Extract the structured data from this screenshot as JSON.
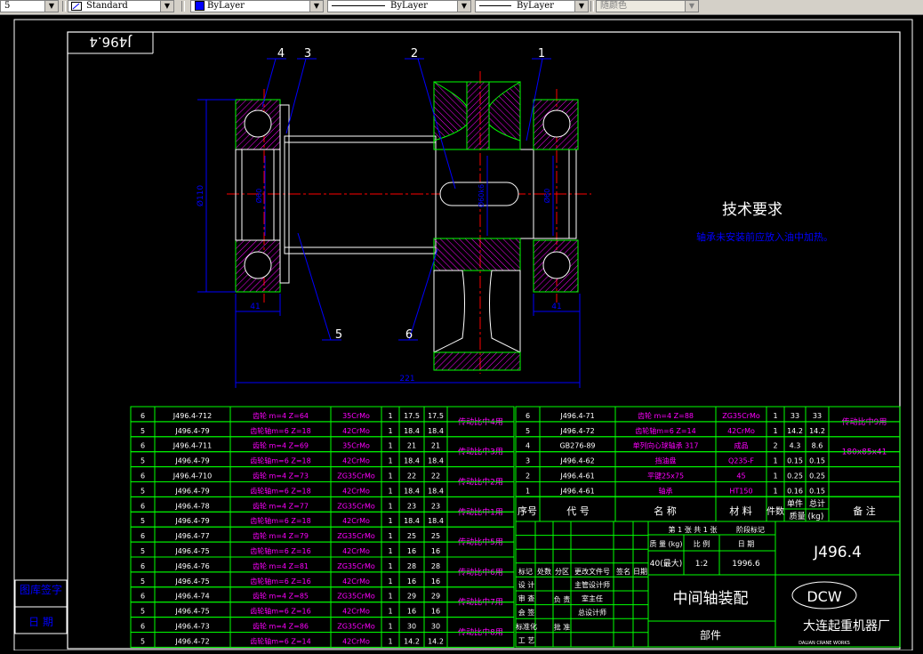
{
  "toolbar": {
    "text_style_partial": "5",
    "text_style": "Standard",
    "color": "ByLayer",
    "linetype": "ByLayer",
    "lineweight": "ByLayer",
    "plotstyle": "随颜色"
  },
  "drawing": {
    "title_block_mirror": "J496.4",
    "balloons": [
      "4",
      "3",
      "2",
      "1",
      "5",
      "6"
    ],
    "dims": {
      "width_left": "41",
      "width_right": "41",
      "overall": "221",
      "dia_bearing": "Ø110",
      "dia_shaft_left": "Ø60",
      "dia_shaft_right": "Ø60",
      "dia_gear": "Ø60k6"
    },
    "tech_req_title": "技术要求",
    "tech_req_text": "轴承未安装前应放入油中加热。",
    "left_table": [
      [
        "6",
        "J496.4-712",
        "齿轮 m=4 Z=64",
        "35CrMo",
        "1",
        "17.5",
        "17.5",
        "传动比中4用"
      ],
      [
        "5",
        "J496.4-79",
        "齿轮轴m=6 Z=18",
        "42CrMo",
        "1",
        "18.4",
        "18.4",
        ""
      ],
      [
        "6",
        "J496.4-711",
        "齿轮 m=4 Z=69",
        "35CrMo",
        "1",
        "21",
        "21",
        "传动比中3用"
      ],
      [
        "5",
        "J496.4-79",
        "齿轮轴m=6 Z=18",
        "42CrMo",
        "1",
        "18.4",
        "18.4",
        ""
      ],
      [
        "6",
        "J496.4-710",
        "齿轮 m=4 Z=73",
        "ZG35CrMo",
        "1",
        "22",
        "22",
        "传动比中2用"
      ],
      [
        "5",
        "J496.4-79",
        "齿轮轴m=6 Z=18",
        "42CrMo",
        "1",
        "18.4",
        "18.4",
        ""
      ],
      [
        "6",
        "J496.4-78",
        "齿轮 m=4 Z=77",
        "ZG35CrMo",
        "1",
        "23",
        "23",
        "传动比中1用"
      ],
      [
        "5",
        "J496.4-79",
        "齿轮轴m=6 Z=18",
        "42CrMo",
        "1",
        "18.4",
        "18.4",
        ""
      ],
      [
        "6",
        "J496.4-77",
        "齿轮 m=4 Z=79",
        "ZG35CrMo",
        "1",
        "25",
        "25",
        "传动比中5用"
      ],
      [
        "5",
        "J496.4-75",
        "齿轮轴m=6 Z=16",
        "42CrMo",
        "1",
        "16",
        "16",
        ""
      ],
      [
        "6",
        "J496.4-76",
        "齿轮 m=4 Z=81",
        "ZG35CrMo",
        "1",
        "28",
        "28",
        "传动比中6用"
      ],
      [
        "5",
        "J496.4-75",
        "齿轮轴m=6 Z=16",
        "42CrMo",
        "1",
        "16",
        "16",
        ""
      ],
      [
        "6",
        "J496.4-74",
        "齿轮 m=4 Z=85",
        "ZG35CrMo",
        "1",
        "29",
        "29",
        "传动比中7用"
      ],
      [
        "5",
        "J496.4-75",
        "齿轮轴m=6 Z=16",
        "42CrMo",
        "1",
        "16",
        "16",
        ""
      ],
      [
        "6",
        "J496.4-73",
        "齿轮 m=4 Z=86",
        "ZG35CrMo",
        "1",
        "30",
        "30",
        "传动比中8用"
      ],
      [
        "5",
        "J496.4-72",
        "齿轮轴m=6 Z=14",
        "42CrMo",
        "1",
        "14.2",
        "14.2",
        ""
      ]
    ],
    "right_table": [
      [
        "6",
        "J496.4-71",
        "齿轮 m=4 Z=88",
        "ZG35CrMo",
        "1",
        "33",
        "33",
        "传动比中9用"
      ],
      [
        "5",
        "J496.4-72",
        "齿轮轴m=6 Z=14",
        "42CrMo",
        "1",
        "14.2",
        "14.2",
        ""
      ],
      [
        "4",
        "GB276-89",
        "单列向心球轴承 317",
        "成品",
        "2",
        "4.3",
        "8.6",
        "180x85x41"
      ],
      [
        "3",
        "J496.4-62",
        "挡油盘",
        "Q235-F",
        "1",
        "0.15",
        "0.15",
        ""
      ],
      [
        "2",
        "J496.4-61",
        "平键25x75",
        "45",
        "1",
        "0.25",
        "0.25",
        ""
      ],
      [
        "1",
        "J496.4-61",
        "轴承",
        "HT150",
        "1",
        "0.16",
        "0.15",
        ""
      ]
    ],
    "bom_header": {
      "seq": "序号",
      "code": "代 号",
      "name": "名 称",
      "material": "材 料",
      "qty": "件数",
      "unit_w": "单件",
      "total_w": "总计",
      "weight": "质量 (kg)",
      "remark": "备 注"
    },
    "title_block": {
      "drawing_no": "J496.4",
      "name": "中间轴装配",
      "part_label": "部件",
      "sheet": "第 1 张 共 1 张",
      "stage": "阶段标记",
      "mass_label": "质 量 (kg)",
      "scale_label": "比 例",
      "date_label": "日 期",
      "mass": "40(最大)",
      "scale": "1:2",
      "date": "1996.6",
      "marks": [
        "标记",
        "处数",
        "分区",
        "更改文件号",
        "签名",
        "日期"
      ],
      "roles": [
        "设 计",
        "审 查",
        "会 签",
        "标准化",
        "工 艺"
      ],
      "roles2": [
        "主管设计师",
        "室主任",
        "总设计师",
        "",
        "",
        "",
        ""
      ],
      "roles3": [
        "",
        "",
        "",
        "",
        "负 责",
        "",
        "批 准"
      ],
      "approval": "负责  批准",
      "logo": "DCW",
      "company": "大连起重机器厂",
      "company_en": "DALIAN CRANE WORKS"
    },
    "margin_labels": [
      "图库签字",
      "日 期"
    ]
  }
}
